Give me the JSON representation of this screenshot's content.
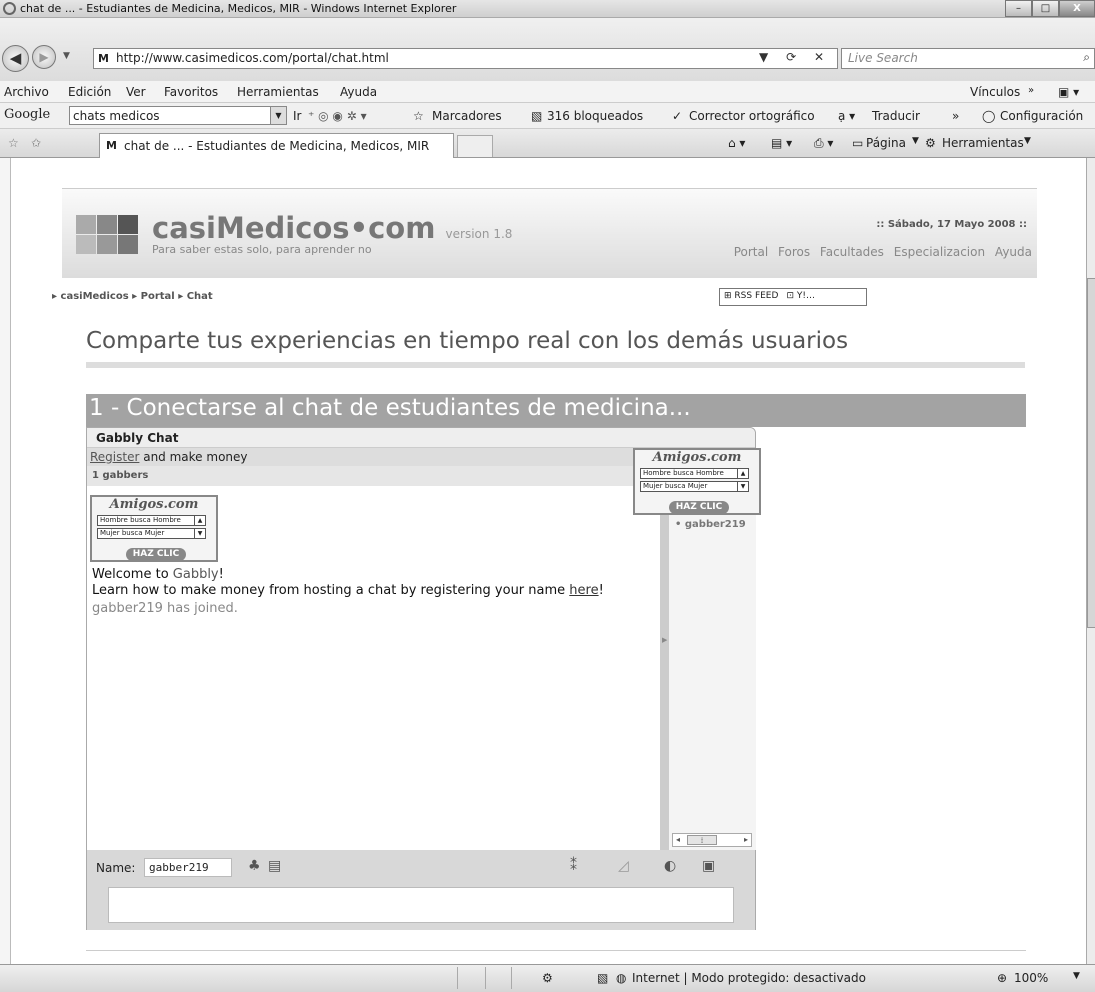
{
  "window": {
    "title": "chat de ... - Estudiantes de Medicina, Medicos, MIR - Windows Internet Explorer",
    "controls": [
      "–",
      "□",
      "X"
    ]
  },
  "address": {
    "url": "http://www.casimedicos.com/portal/chat.html",
    "search_placeholder": "Live Search"
  },
  "menu": [
    "Archivo",
    "Edición",
    "Ver",
    "Favoritos",
    "Herramientas",
    "Ayuda"
  ],
  "menu_right": "Vínculos",
  "google_bar": {
    "logo": "Google",
    "query": "chats medicos",
    "go": "Ir",
    "bookmarks": "Marcadores",
    "blocked": "316 bloqueados",
    "spell": "Corrector ortográfico",
    "translate": "Traducir",
    "settings": "Configuración"
  },
  "tabs": {
    "active": "chat de ... - Estudiantes de Medicina, Medicos, MIR",
    "page_menu": "Página",
    "tools_menu": "Herramientas"
  },
  "site": {
    "brand": "casiMedicos•com",
    "version": "version 1.8",
    "tagline": "Para saber estas solo, para aprender no",
    "date": ":: Sábado, 17 Mayo 2008 ::",
    "nav": [
      "Portal",
      "Foros",
      "Facultades",
      "Especializacion",
      "Ayuda"
    ],
    "breadcrumb": "casiMedicos ▸ Portal ▸ Chat",
    "rss": "RSS FEED"
  },
  "headline": "Comparte tus experiencias en tiempo real con los demás usuarios",
  "section_title": "1 - Conectarse al chat de estudiantes de medicina...",
  "chat": {
    "title": "Gabbly Chat",
    "register_link": "Register",
    "register_text": " and make money",
    "count": "1 gabbers",
    "users": [
      "gabber219"
    ],
    "ad": {
      "logo": "Amigos.com",
      "opt1": "Hombre busca Hombre",
      "opt2": "Mujer busca Mujer",
      "cta": "HAZ CLIC"
    },
    "welcome_pre": "Welcome to ",
    "welcome_brand": "Gabbly",
    "welcome_post": "!",
    "learn_pre": "Learn how to make money from hosting a chat by registering your name ",
    "learn_link": "here",
    "learn_post": "!",
    "joined": "gabber219 has joined.",
    "name_label": "Name:",
    "name_value": "gabber219"
  },
  "status": {
    "zone": "Internet | Modo protegido: desactivado",
    "zoom": "100%"
  }
}
